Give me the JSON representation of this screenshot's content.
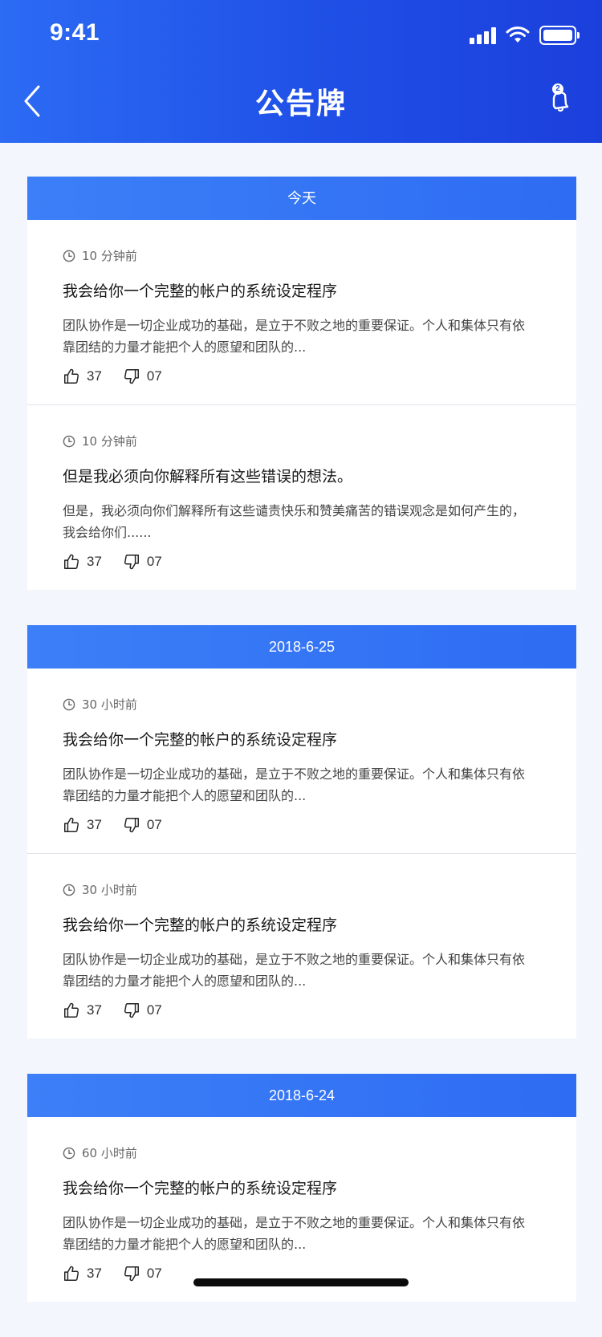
{
  "status_bar": {
    "time": "9:41"
  },
  "header": {
    "title": "公告牌",
    "bell_badge": "2"
  },
  "sections": [
    {
      "date": "今天",
      "notices": [
        {
          "time": "10 分钟前",
          "title": "我会给你一个完整的帐户的系统设定程序",
          "body": "团队协作是一切企业成功的基础，是立于不败之地的重要保证。个人和集体只有依靠团结的力量才能把个人的愿望和团队的...",
          "likes": "37",
          "dislikes": "07"
        },
        {
          "time": "10 分钟前",
          "title": "但是我必须向你解释所有这些错误的想法。",
          "body": "但是，我必须向你们解释所有这些谴责快乐和赞美痛苦的错误观念是如何产生的，我会给你们......",
          "likes": "37",
          "dislikes": "07"
        }
      ]
    },
    {
      "date": "2018-6-25",
      "notices": [
        {
          "time": "30 小时前",
          "title": "我会给你一个完整的帐户的系统设定程序",
          "body": "团队协作是一切企业成功的基础，是立于不败之地的重要保证。个人和集体只有依靠团结的力量才能把个人的愿望和团队的...",
          "likes": "37",
          "dislikes": "07"
        },
        {
          "time": "30 小时前",
          "title": "我会给你一个完整的帐户的系统设定程序",
          "body": "团队协作是一切企业成功的基础，是立于不败之地的重要保证。个人和集体只有依靠团结的力量才能把个人的愿望和团队的...",
          "likes": "37",
          "dislikes": "07"
        }
      ]
    },
    {
      "date": "2018-6-24",
      "notices": [
        {
          "time": "60 小时前",
          "title": "我会给你一个完整的帐户的系统设定程序",
          "body": "团队协作是一切企业成功的基础，是立于不败之地的重要保证。个人和集体只有依靠团结的力量才能把个人的愿望和团队的...",
          "likes": "37",
          "dislikes": "07"
        }
      ]
    }
  ],
  "icons": {
    "back": "chevron-left-icon",
    "bell": "bell-icon",
    "clock": "clock-icon",
    "like": "thumbs-up-icon",
    "dislike": "thumbs-down-icon"
  },
  "colors": {
    "header_start": "#2c6bf4",
    "header_end": "#1c3fdc",
    "date_bar": "#3c7ff7",
    "page_bg": "#f3f6fd"
  }
}
